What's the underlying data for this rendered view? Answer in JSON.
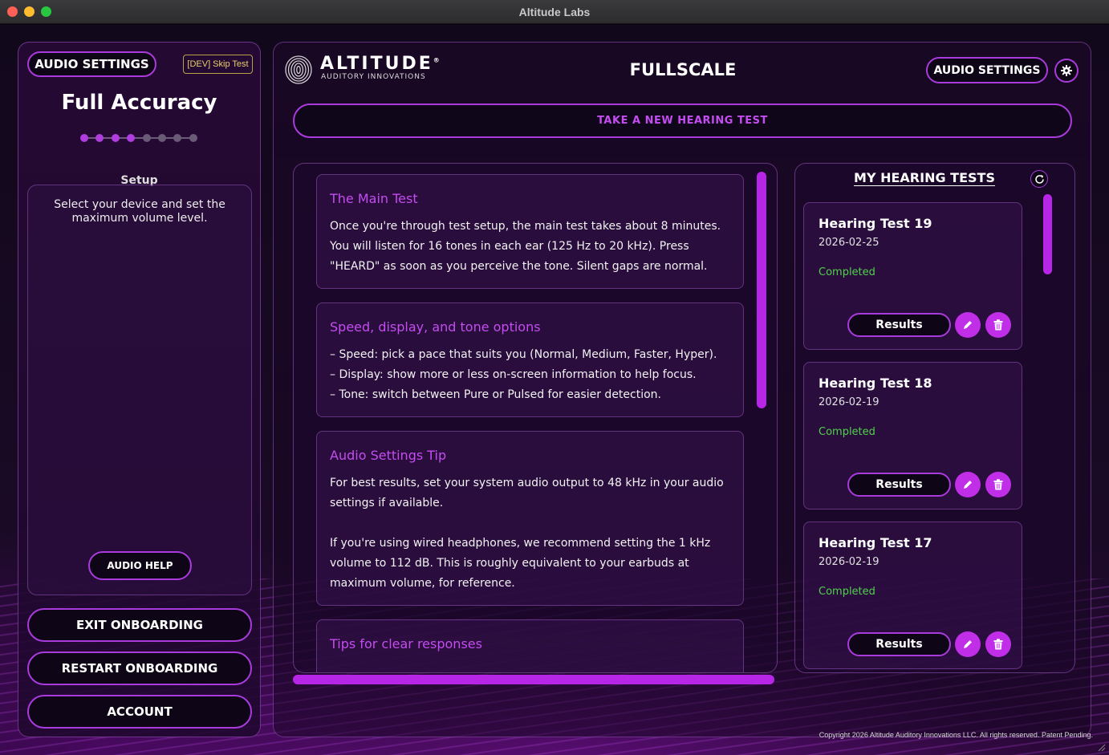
{
  "window": {
    "title": "Altitude Labs"
  },
  "left": {
    "audio_settings_label": "AUDIO SETTINGS",
    "dev_skip_label": "[DEV] Skip Test",
    "title": "Full Accuracy",
    "steps_total": 8,
    "steps_completed": 4,
    "step_label": "Setup",
    "instructions": "Select your device and set the maximum volume level.",
    "audio_help_label": "AUDIO HELP",
    "exit_label": "EXIT ONBOARDING",
    "restart_label": "RESTART ONBOARDING",
    "account_label": "ACCOUNT"
  },
  "header": {
    "logo_word": "ALTITUDE",
    "logo_reg": "®",
    "logo_sub": "AUDITORY INNOVATIONS",
    "app_name": "FULLSCALE",
    "audio_settings_label": "AUDIO SETTINGS",
    "new_test_label": "TAKE A NEW HEARING TEST"
  },
  "cards": [
    {
      "title": "The Main Test",
      "paragraphs": [
        "Once you're through test setup, the main test takes about 8 minutes. You will listen for 16 tones in each ear (125 Hz to 20 kHz). Press \"HEARD\" as soon as you perceive the tone. Silent gaps are normal."
      ]
    },
    {
      "title": "Speed, display, and tone options",
      "lines": [
        "– Speed: pick a pace that suits you (Normal, Medium, Faster, Hyper).",
        "– Display: show more or less on-screen information to help focus.",
        "– Tone: switch between Pure or Pulsed for easier detection."
      ]
    },
    {
      "title": "Audio Settings Tip",
      "paragraphs": [
        "For best results, set your system audio output to 48 kHz in your audio settings if available.",
        "If you're using wired headphones, we recommend setting the 1 kHz volume to 112 dB. This is roughly equivalent to your earbuds at maximum volume, for reference."
      ]
    },
    {
      "title": "Tips for clear responses",
      "paragraphs": []
    }
  ],
  "tests": {
    "title": "MY HEARING TESTS",
    "items": [
      {
        "name": "Hearing Test 19",
        "date": "2026-02-25",
        "status": "Completed",
        "results_label": "Results"
      },
      {
        "name": "Hearing Test 18",
        "date": "2026-02-19",
        "status": "Completed",
        "results_label": "Results"
      },
      {
        "name": "Hearing Test 17",
        "date": "2026-02-19",
        "status": "Completed",
        "results_label": "Results"
      }
    ]
  },
  "footer": {
    "copyright": "Copyright 2026 Altitude Auditory Innovations LLC. All rights reserved. Patent Pending."
  },
  "colors": {
    "accent": "#b726e6",
    "accent_text": "#c44cf0",
    "status_green": "#4fd24a",
    "dev_yellow": "#e8d06a"
  },
  "icons": {
    "settings": "gear-icon",
    "refresh": "refresh-icon",
    "edit": "pencil-icon",
    "delete": "trash-icon"
  }
}
